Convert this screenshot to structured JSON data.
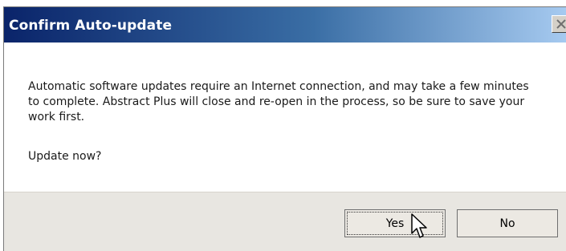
{
  "dialog": {
    "title": "Confirm Auto-update",
    "message": "Automatic software updates require an Internet connection, and may take a few minutes to complete.  Abstract Plus will close and re-open in the process, so be sure to save your work first.",
    "question": "Update now?",
    "close_icon": "close-x-icon",
    "buttons": {
      "yes_label": "Yes",
      "no_label": "No"
    }
  },
  "colors": {
    "titlebar_start": "#0a246a",
    "titlebar_end": "#a6caf0",
    "footer_bg": "#e8e6e1"
  },
  "cursor": "arrow-cursor"
}
